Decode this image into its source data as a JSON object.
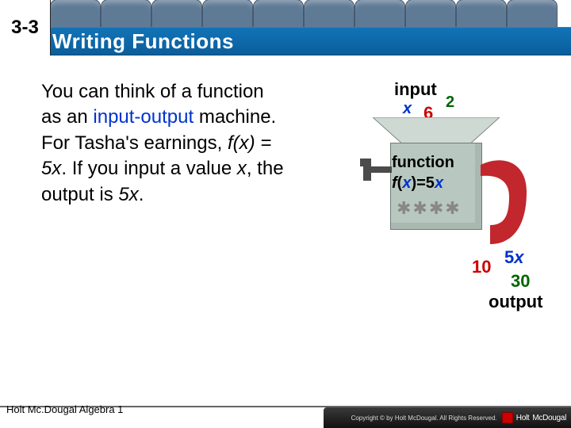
{
  "header": {
    "section_number": "3-3",
    "title": "Writing Functions"
  },
  "body": {
    "text_pre": "You can think of a function as an ",
    "io_word": "input-output",
    "text_mid": " machine. For Tasha's earnings, ",
    "fx_eq": "f(x) = 5x",
    "text_mid2": ". If you input a value ",
    "x_word": "x",
    "text_mid3": ", the output is ",
    "five_x": "5x",
    "text_end": "."
  },
  "machine": {
    "input_label": "input",
    "x_label": "x",
    "example1_in": "6",
    "example2_in": "2",
    "function_label": "function",
    "function_eq_f": "f",
    "function_eq_open": "(",
    "function_eq_x": "x",
    "function_eq_close": ")=5",
    "function_eq_x2": "x",
    "example1_out": "10",
    "five": "5",
    "out_x": "x",
    "example2_out": "30",
    "output_label": "output",
    "gears": "✱✱✱✱"
  },
  "footer": {
    "text": "Holt Mc.Dougal Algebra 1",
    "brand1": "Holt",
    "brand2": "McDougal",
    "copyright": "Copyright © by Holt McDougal. All Rights Reserved."
  }
}
